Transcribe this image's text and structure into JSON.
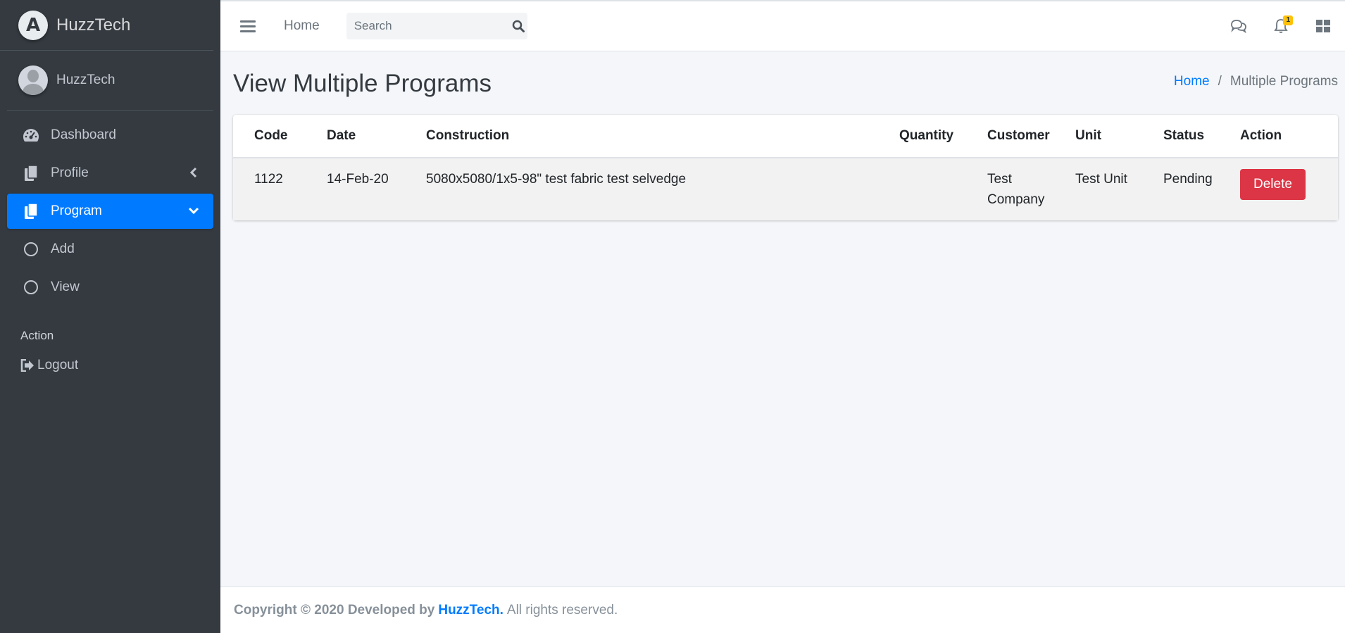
{
  "brand": {
    "name": "HuzzTech",
    "logo_letter": "A"
  },
  "user": {
    "name": "HuzzTech"
  },
  "sidebar": {
    "items": [
      {
        "label": "Dashboard",
        "icon": "tachometer-icon"
      },
      {
        "label": "Profile",
        "icon": "copy-icon"
      },
      {
        "label": "Program",
        "icon": "copy-icon"
      },
      {
        "label": "Add",
        "icon": "circle-icon"
      },
      {
        "label": "View",
        "icon": "circle-icon"
      }
    ],
    "header": "Action",
    "logout": "Logout"
  },
  "topbar": {
    "home": "Home",
    "search_placeholder": "Search",
    "notification_count": "1"
  },
  "page": {
    "title": "View Multiple Programs",
    "breadcrumb": {
      "home": "Home",
      "separator": "/",
      "current": "Multiple Programs"
    }
  },
  "table": {
    "headers": [
      "Code",
      "Date",
      "Construction",
      "Quantity",
      "Customer",
      "Unit",
      "Status",
      "Action"
    ],
    "rows": [
      {
        "code": "1122",
        "date": "14-Feb-20",
        "construction": "5080x5080/1x5-98\" test fabric test selvedge",
        "quantity": "",
        "customer": "Test Company",
        "unit": "Test Unit",
        "status": "Pending",
        "action": "Delete"
      }
    ]
  },
  "footer": {
    "copyright": "Copyright © 2020 Developed by",
    "brand": "HuzzTech.",
    "rights": "All rights reserved."
  },
  "colors": {
    "sidebar_bg": "#343a40",
    "active": "#007bff",
    "danger": "#dc3545",
    "badge": "#ffc107"
  }
}
